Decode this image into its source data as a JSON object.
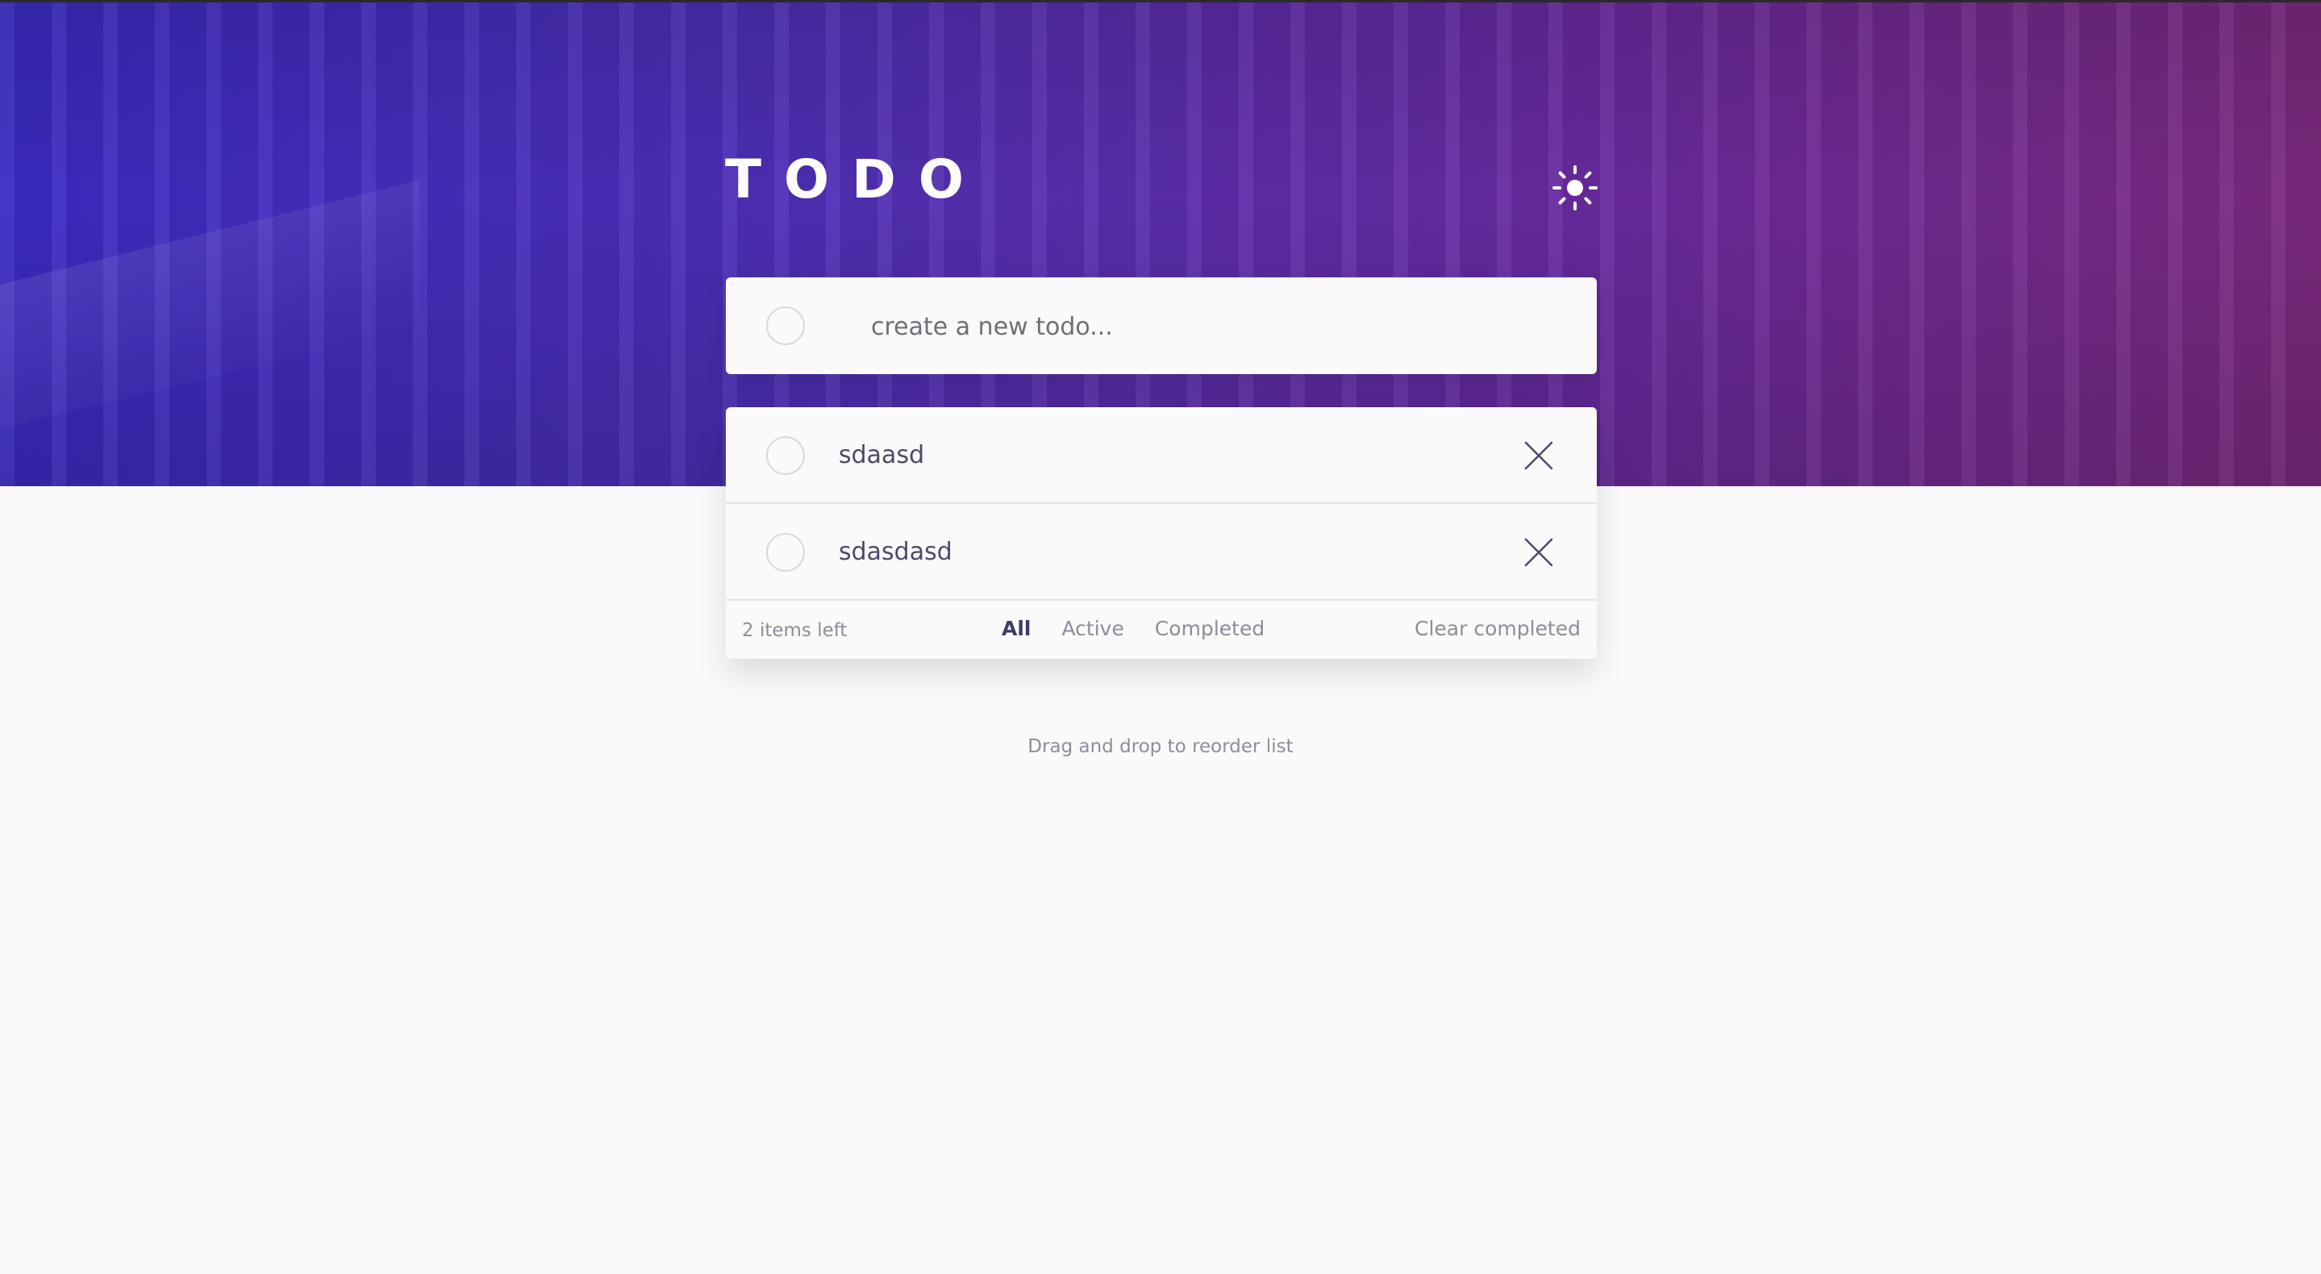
{
  "header": {
    "title": "TODO",
    "theme_toggle_icon": "sun-icon"
  },
  "new_todo": {
    "placeholder": "create a new todo...",
    "value": ""
  },
  "todos": [
    {
      "text": "sdaasd",
      "completed": false
    },
    {
      "text": "sdasdasd",
      "completed": false
    }
  ],
  "footer": {
    "items_left": "2 items left",
    "filters": [
      "All",
      "Active",
      "Completed"
    ],
    "active_filter": "All",
    "clear_label": "Clear completed"
  },
  "hint": "Drag and drop to reorder list",
  "colors": {
    "accent_gradient_start": "#3b2bc4",
    "accent_gradient_end": "#7b2a7e",
    "text_primary": "#494c6b",
    "text_muted": "#8d8e9c",
    "background": "#fafafa"
  }
}
